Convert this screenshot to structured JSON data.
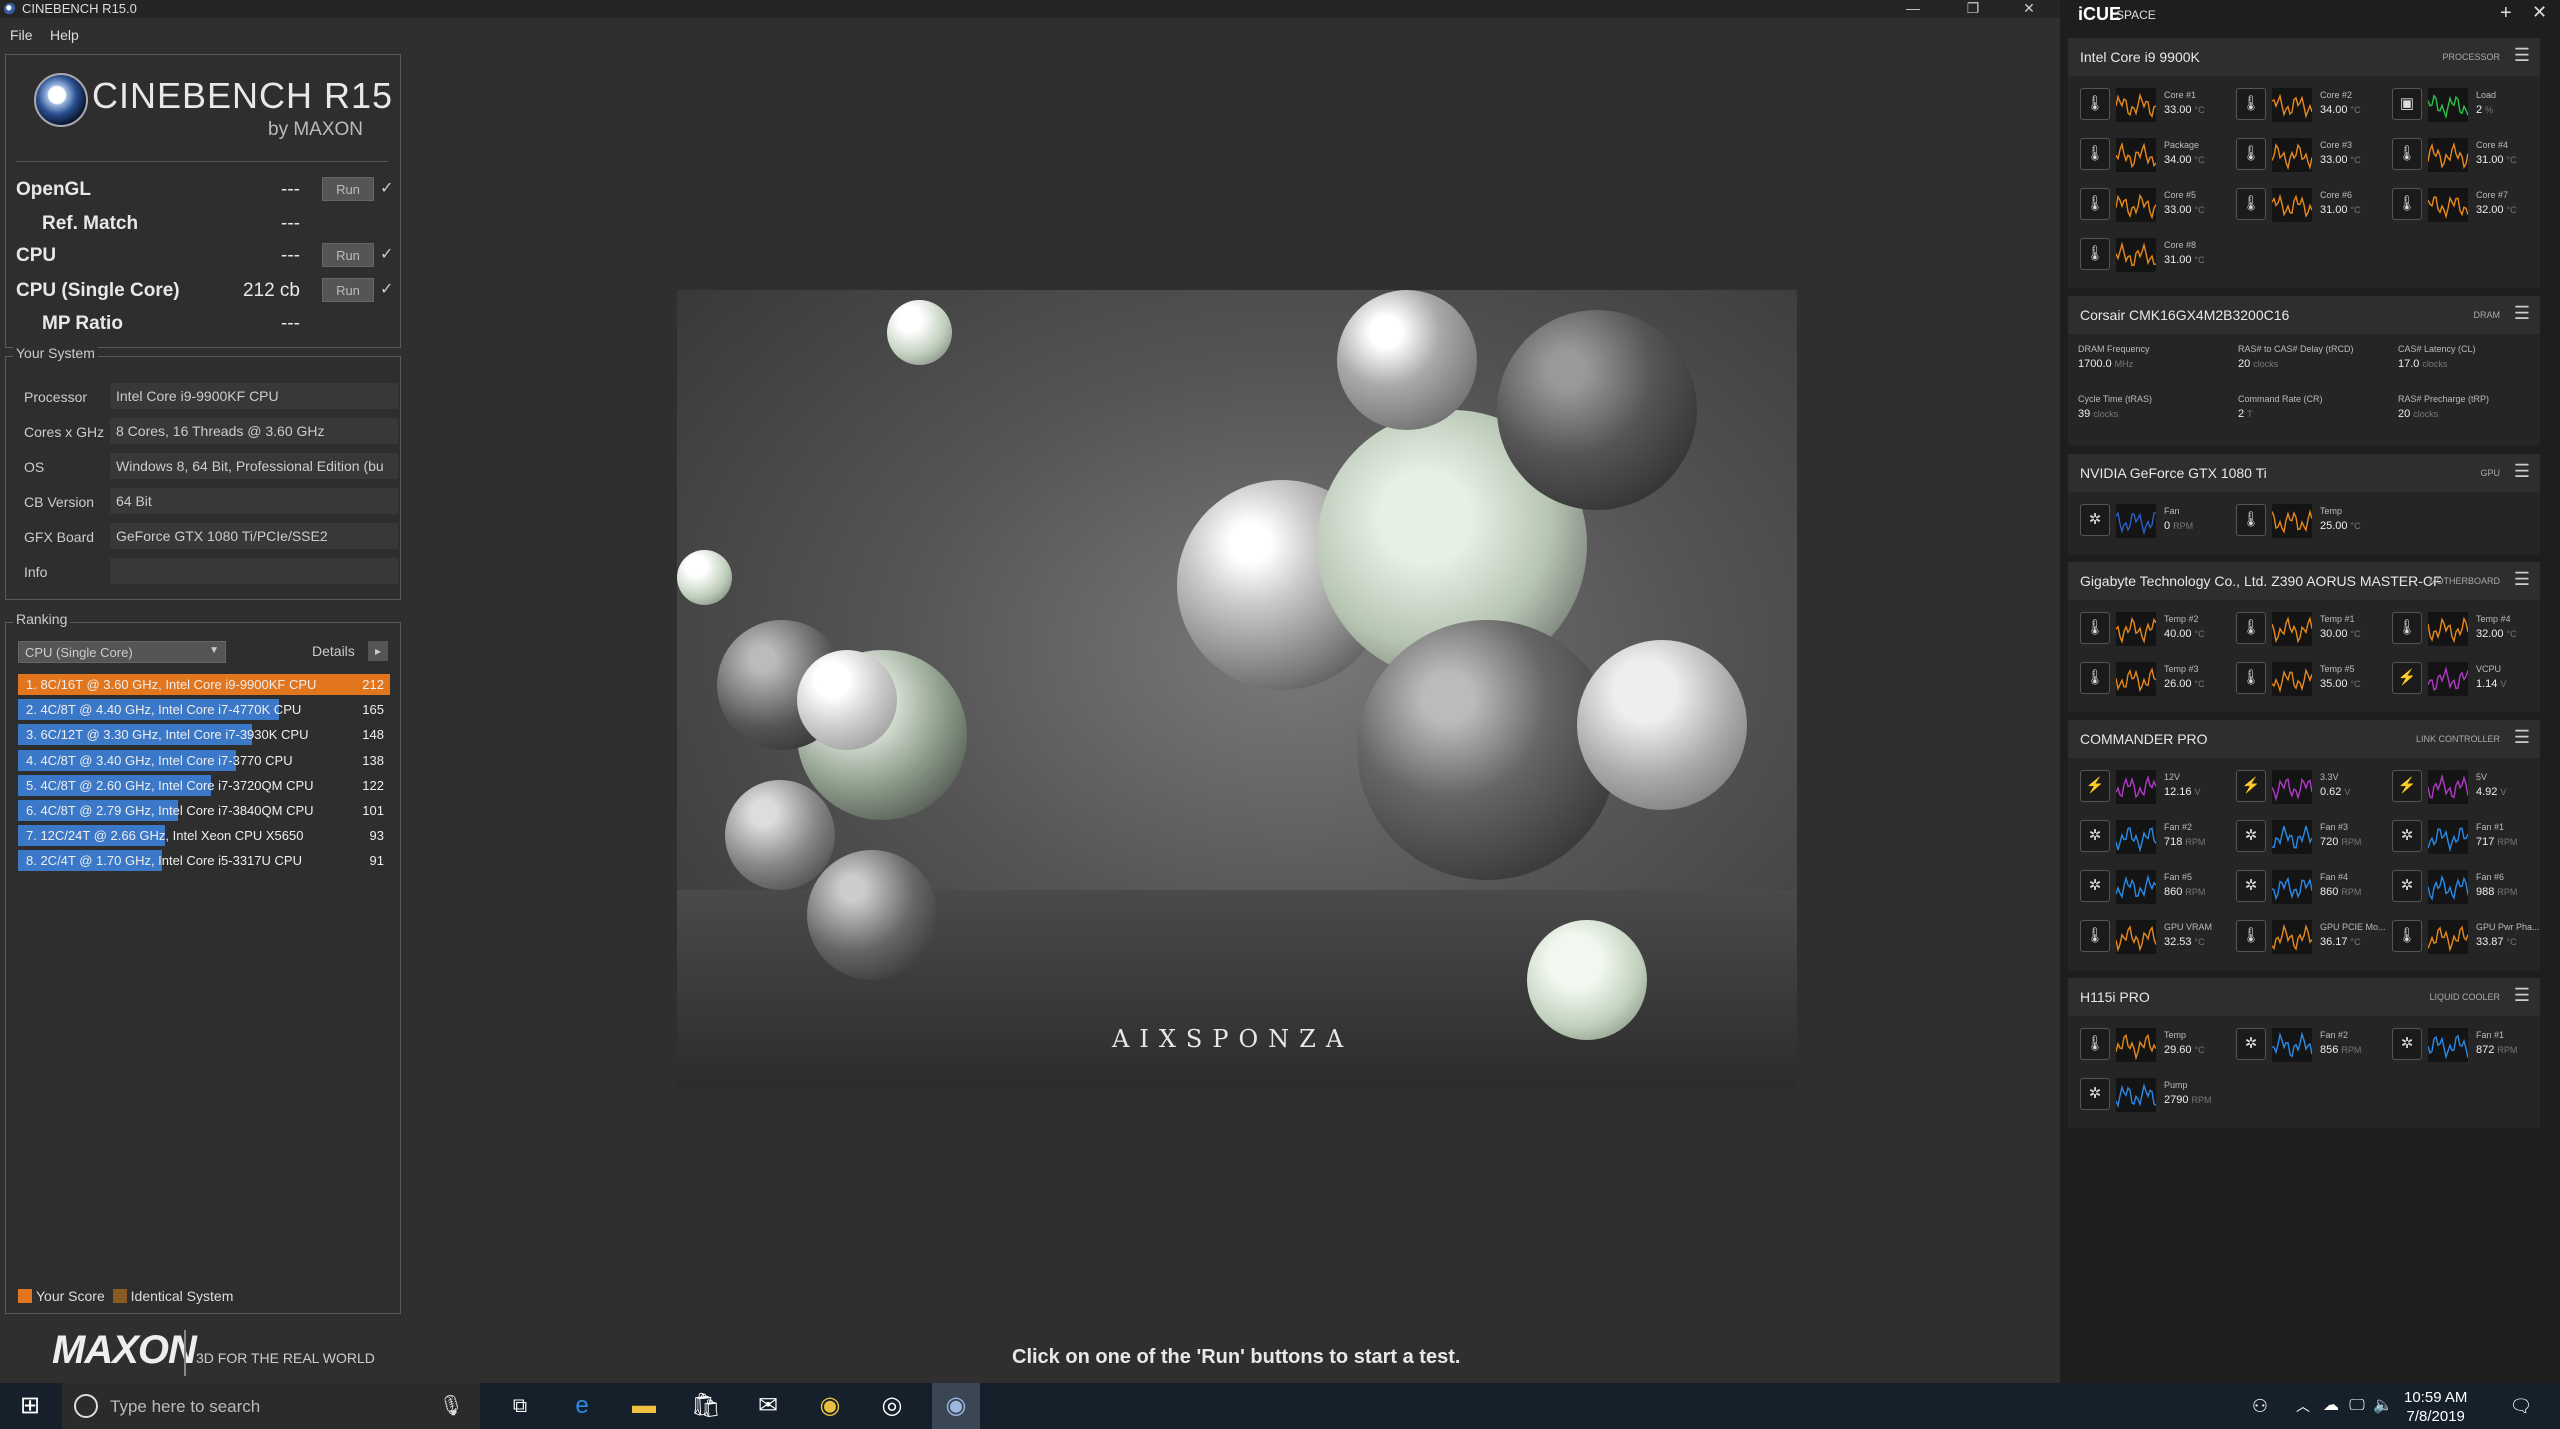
{
  "window": {
    "title": "CINEBENCH R15.0",
    "minimize": "—",
    "restore": "❐",
    "close": "✕"
  },
  "menu": [
    "File",
    "Help"
  ],
  "logo": {
    "title": "CINEBENCH R15",
    "by": "by MAXON"
  },
  "tests": [
    {
      "label": "OpenGL",
      "score": "---",
      "run": "Run",
      "check": "✓"
    },
    {
      "label": "Ref. Match",
      "score": "---"
    },
    {
      "label": "CPU",
      "score": "---",
      "run": "Run",
      "check": "✓"
    },
    {
      "label": "CPU (Single Core)",
      "score": "212 cb",
      "run": "Run",
      "check": "✓"
    },
    {
      "label": "MP Ratio",
      "score": "---"
    }
  ],
  "system": {
    "title": "Your System",
    "rows": [
      {
        "k": "Processor",
        "v": "Intel Core i9-9900KF CPU"
      },
      {
        "k": "Cores x GHz",
        "v": "8 Cores, 16 Threads @ 3.60 GHz"
      },
      {
        "k": "OS",
        "v": "Windows 8, 64 Bit, Professional Edition (bu"
      },
      {
        "k": "CB Version",
        "v": "64 Bit"
      },
      {
        "k": "GFX Board",
        "v": "GeForce GTX 1080 Ti/PCIe/SSE2"
      },
      {
        "k": "Info",
        "v": ""
      }
    ]
  },
  "ranking": {
    "title": "Ranking",
    "select": "CPU (Single Core)",
    "details": "Details",
    "details_btn": "▸",
    "max": 212,
    "rows": [
      {
        "text": "1. 8C/16T @ 3.60 GHz, Intel Core i9-9900KF CPU",
        "score": 212,
        "mine": true
      },
      {
        "text": "2. 4C/8T @ 4.40 GHz, Intel Core i7-4770K CPU",
        "score": 165
      },
      {
        "text": "3. 6C/12T @ 3.30 GHz,  Intel Core i7-3930K CPU",
        "score": 148
      },
      {
        "text": "4. 4C/8T @ 3.40 GHz,  Intel Core i7-3770 CPU",
        "score": 138
      },
      {
        "text": "5. 4C/8T @ 2.60 GHz, Intel Core i7-3720QM CPU",
        "score": 122
      },
      {
        "text": "6. 4C/8T @ 2.79 GHz,  Intel Core i7-3840QM CPU",
        "score": 101
      },
      {
        "text": "7. 12C/24T @ 2.66 GHz, Intel Xeon CPU X5650",
        "score": 93
      },
      {
        "text": "8. 2C/4T @ 1.70 GHz,  Intel Core i5-3317U CPU",
        "score": 91
      }
    ],
    "legend": {
      "your_score": "Your Score",
      "identical": "Identical System"
    }
  },
  "colors": {
    "your_score": "#e2761f",
    "identical": "#8a5a24",
    "bar": "#3c78c8"
  },
  "footer": {
    "brand": "MAXON",
    "tagline": "3D FOR THE REAL WORLD",
    "status": "Click on one of the 'Run' buttons to start a test."
  },
  "render": {
    "watermark": "AIXSPONZA"
  },
  "taskbar": {
    "search_placeholder": "Type here to search",
    "icons": [
      "windows-icon",
      "task-view-icon",
      "edge-icon",
      "file-explorer-icon",
      "store-icon",
      "mail-icon",
      "chrome-icon",
      "icue-icon",
      "cinebench-icon"
    ],
    "time": "10:59 AM",
    "date": "7/8/2019"
  },
  "icue": {
    "brand": "iCUE",
    "space": "SPACE",
    "add": "+",
    "close": "✕",
    "devices": [
      {
        "name": "Intel Core i9 9900K",
        "type": "PROCESSOR",
        "menu": "☰",
        "tiles": [
          {
            "icon": "🌡",
            "name": "Core #1",
            "value": "33.00",
            "unit": "°C",
            "color": "#e8891c"
          },
          {
            "icon": "🌡",
            "name": "Core #2",
            "value": "34.00",
            "unit": "°C",
            "color": "#e8891c"
          },
          {
            "icon": "▣",
            "name": "Load",
            "value": "2",
            "unit": "%",
            "color": "#2ec24a"
          },
          {
            "icon": "🌡",
            "name": "Package",
            "value": "34.00",
            "unit": "°C",
            "color": "#e8891c"
          },
          {
            "icon": "🌡",
            "name": "Core #3",
            "value": "33.00",
            "unit": "°C",
            "color": "#e8891c"
          },
          {
            "icon": "🌡",
            "name": "Core #4",
            "value": "31.00",
            "unit": "°C",
            "color": "#e8891c"
          },
          {
            "icon": "🌡",
            "name": "Core #5",
            "value": "33.00",
            "unit": "°C",
            "color": "#e8891c"
          },
          {
            "icon": "🌡",
            "name": "Core #6",
            "value": "31.00",
            "unit": "°C",
            "color": "#e8891c"
          },
          {
            "icon": "🌡",
            "name": "Core #7",
            "value": "32.00",
            "unit": "°C",
            "color": "#e8891c"
          },
          {
            "icon": "🌡",
            "name": "Core #8",
            "value": "31.00",
            "unit": "°C",
            "color": "#e8891c"
          }
        ]
      },
      {
        "name": "Corsair CMK16GX4M2B3200C16",
        "type": "DRAM",
        "menu": "☰",
        "kv": [
          {
            "name": "DRAM Frequency",
            "value": "1700.0",
            "unit": "MHz"
          },
          {
            "name": "RAS# to CAS# Delay (tRCD)",
            "value": "20",
            "unit": "clocks"
          },
          {
            "name": "CAS# Latency (CL)",
            "value": "17.0",
            "unit": "clocks"
          },
          {
            "name": "Cycle Time (tRAS)",
            "value": "39",
            "unit": "clocks"
          },
          {
            "name": "Command Rate (CR)",
            "value": "2",
            "unit": "T"
          },
          {
            "name": "RAS# Precharge (tRP)",
            "value": "20",
            "unit": "clocks"
          }
        ]
      },
      {
        "name": "NVIDIA GeForce GTX 1080 Ti",
        "type": "GPU",
        "menu": "☰",
        "tiles": [
          {
            "icon": "✲",
            "name": "Fan",
            "value": "0",
            "unit": "RPM",
            "color": "#2a5fc8"
          },
          {
            "icon": "🌡",
            "name": "Temp",
            "value": "25.00",
            "unit": "°C",
            "color": "#e8891c"
          }
        ]
      },
      {
        "name": "Gigabyte Technology Co., Ltd. Z390 AORUS MASTER-CF",
        "type": "MOTHERBOARD",
        "menu": "☰",
        "tiles": [
          {
            "icon": "🌡",
            "name": "Temp #2",
            "value": "40.00",
            "unit": "°C",
            "color": "#e8891c"
          },
          {
            "icon": "🌡",
            "name": "Temp #1",
            "value": "30.00",
            "unit": "°C",
            "color": "#e8891c"
          },
          {
            "icon": "🌡",
            "name": "Temp #4",
            "value": "32.00",
            "unit": "°C",
            "color": "#e8891c"
          },
          {
            "icon": "🌡",
            "name": "Temp #3",
            "value": "26.00",
            "unit": "°C",
            "color": "#e8891c"
          },
          {
            "icon": "🌡",
            "name": "Temp #5",
            "value": "35.00",
            "unit": "°C",
            "color": "#e8891c"
          },
          {
            "icon": "⚡",
            "name": "VCPU",
            "value": "1.14",
            "unit": "V",
            "color": "#b03ac8"
          }
        ]
      },
      {
        "name": "COMMANDER PRO",
        "type": "LINK CONTROLLER",
        "menu": "☰",
        "tiles": [
          {
            "icon": "⚡",
            "name": "12V",
            "value": "12.16",
            "unit": "V",
            "color": "#b03ac8"
          },
          {
            "icon": "⚡",
            "name": "3.3V",
            "value": "0.62",
            "unit": "V",
            "color": "#b03ac8"
          },
          {
            "icon": "⚡",
            "name": "5V",
            "value": "4.92",
            "unit": "V",
            "color": "#b03ac8"
          },
          {
            "icon": "✲",
            "name": "Fan #2",
            "value": "718",
            "unit": "RPM",
            "color": "#2a8ae8"
          },
          {
            "icon": "✲",
            "name": "Fan #3",
            "value": "720",
            "unit": "RPM",
            "color": "#2a8ae8"
          },
          {
            "icon": "✲",
            "name": "Fan #1",
            "value": "717",
            "unit": "RPM",
            "color": "#2a8ae8"
          },
          {
            "icon": "✲",
            "name": "Fan #5",
            "value": "860",
            "unit": "RPM",
            "color": "#2a8ae8"
          },
          {
            "icon": "✲",
            "name": "Fan #4",
            "value": "860",
            "unit": "RPM",
            "color": "#2a8ae8"
          },
          {
            "icon": "✲",
            "name": "Fan #6",
            "value": "988",
            "unit": "RPM",
            "color": "#2a8ae8"
          },
          {
            "icon": "🌡",
            "name": "GPU VRAM",
            "value": "32.53",
            "unit": "°C",
            "color": "#e8891c"
          },
          {
            "icon": "🌡",
            "name": "GPU PCIE Mo...",
            "value": "36.17",
            "unit": "°C",
            "color": "#e8891c"
          },
          {
            "icon": "🌡",
            "name": "GPU Pwr Pha...",
            "value": "33.87",
            "unit": "°C",
            "color": "#e8891c"
          }
        ]
      },
      {
        "name": "H115i PRO",
        "type": "LIQUID COOLER",
        "menu": "☰",
        "tiles": [
          {
            "icon": "🌡",
            "name": "Temp",
            "value": "29.60",
            "unit": "°C",
            "color": "#e8891c"
          },
          {
            "icon": "✲",
            "name": "Fan #2",
            "value": "856",
            "unit": "RPM",
            "color": "#2a8ae8"
          },
          {
            "icon": "✲",
            "name": "Fan #1",
            "value": "872",
            "unit": "RPM",
            "color": "#2a8ae8"
          },
          {
            "icon": "✲",
            "name": "Pump",
            "value": "2790",
            "unit": "RPM",
            "color": "#2a8ae8"
          }
        ]
      }
    ]
  }
}
